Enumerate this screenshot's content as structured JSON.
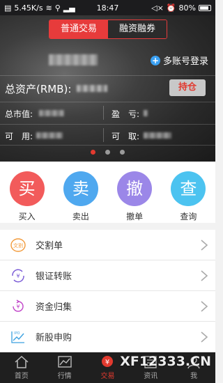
{
  "status_bar": {
    "speed": "5.45K/s",
    "time": "18:47",
    "battery": "80%"
  },
  "segment": {
    "tabs": [
      {
        "label": "普通交易",
        "active": true
      },
      {
        "label": "融资融券",
        "active": false
      }
    ]
  },
  "account": {
    "multi_login_label": "多账号登录"
  },
  "assets": {
    "total_label": "总资产(RMB):",
    "hold_button": "持仓",
    "market_value_label": "总市值:",
    "profit_label": "盈　亏:",
    "available_label": "可　用:",
    "withdrawable_label": "可　取:"
  },
  "pager": {
    "count": 3,
    "active_index": 0
  },
  "actions": [
    {
      "glyph": "买",
      "label": "买入",
      "color": "#f25b5b"
    },
    {
      "glyph": "卖",
      "label": "卖出",
      "color": "#4fa8ef"
    },
    {
      "glyph": "撤",
      "label": "撤单",
      "color": "#9b87e8"
    },
    {
      "glyph": "查",
      "label": "查询",
      "color": "#4cc3f0"
    }
  ],
  "list": [
    {
      "label": "交割单",
      "icon": "document-icon"
    },
    {
      "label": "银证转账",
      "icon": "transfer-icon"
    },
    {
      "label": "资金归集",
      "icon": "fund-collect-icon"
    },
    {
      "label": "新股申购",
      "icon": "ipo-icon"
    }
  ],
  "tabbar": [
    {
      "label": "首页",
      "icon": "home-icon",
      "active": false
    },
    {
      "label": "行情",
      "icon": "chart-icon",
      "active": false
    },
    {
      "label": "交易",
      "icon": "trade-icon",
      "active": true
    },
    {
      "label": "资讯",
      "icon": "news-icon",
      "active": false
    },
    {
      "label": "我",
      "icon": "profile-icon",
      "active": false
    }
  ],
  "watermark": "XF12333.CN",
  "colors": {
    "accent": "#e23a2f",
    "segment_active": "#e73b3b"
  }
}
